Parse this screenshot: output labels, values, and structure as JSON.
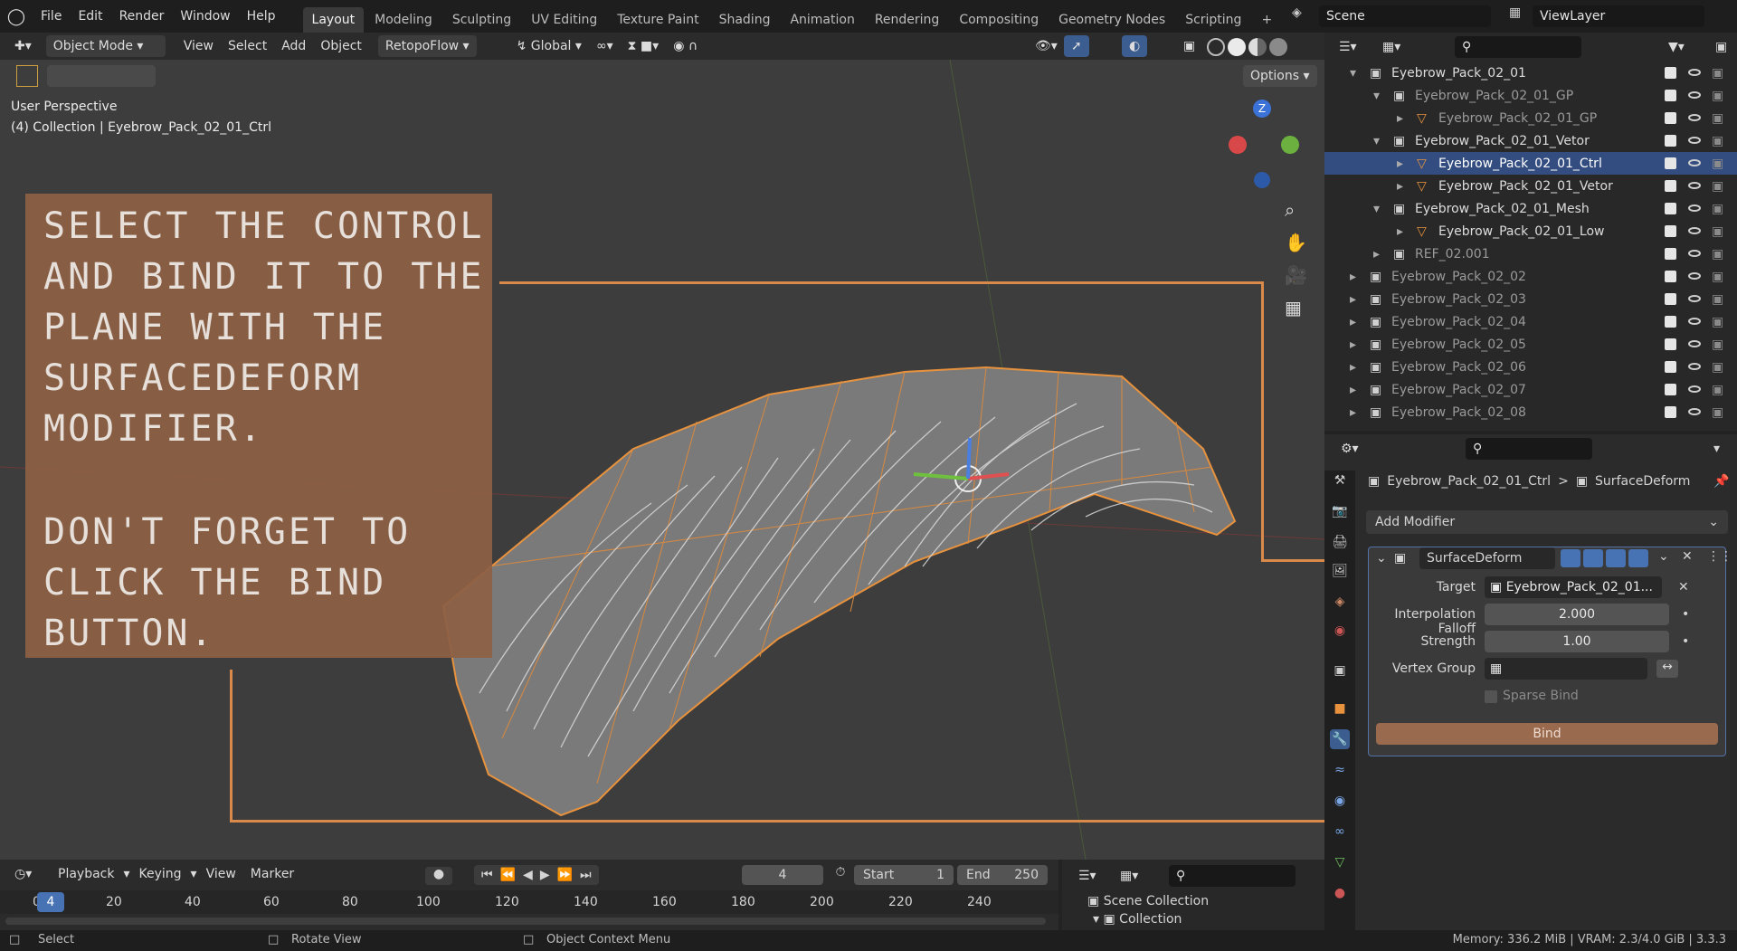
{
  "colors": {
    "accent": "#4772b3",
    "annotation": "#8d6045",
    "orange": "#d98a4a",
    "bind_button": "#9a6a4e"
  },
  "topbar": {
    "menus": [
      "File",
      "Edit",
      "Render",
      "Window",
      "Help"
    ],
    "workspaces": [
      "Layout",
      "Modeling",
      "Sculpting",
      "UV Editing",
      "Texture Paint",
      "Shading",
      "Animation",
      "Rendering",
      "Compositing",
      "Geometry Nodes",
      "Scripting"
    ],
    "active_workspace": "Layout",
    "add_tab": "+",
    "scene": "Scene",
    "view_layer": "ViewLayer"
  },
  "viewport_header": {
    "mode": "Object Mode",
    "menus": [
      "View",
      "Select",
      "Add",
      "Object"
    ],
    "addon": "RetopoFlow",
    "orientation": "Global",
    "options": "Options"
  },
  "viewport": {
    "perspective": "User Perspective",
    "collection_info": "(4) Collection | Eyebrow_Pack_02_01_Ctrl",
    "gizmo_z": "Z"
  },
  "annotation": {
    "text1": "Select the control and bind it to the plane with the SurfaceDeform modifier.",
    "text2": "Don't forget to click the Bind button."
  },
  "timeline": {
    "menus": [
      "Playback",
      "Keying",
      "View",
      "Marker"
    ],
    "current_frame": "4",
    "start_label": "Start",
    "start": "1",
    "end_label": "End",
    "end": "250",
    "ticks": [
      "0",
      "20",
      "40",
      "60",
      "80",
      "100",
      "120",
      "140",
      "160",
      "180",
      "200",
      "220",
      "240"
    ]
  },
  "outliner": {
    "rows": [
      {
        "label": "Eyebrow_Pack_02_01",
        "indent": 0,
        "dim": false
      },
      {
        "label": "Eyebrow_Pack_02_01_GP",
        "indent": 1,
        "dim": true
      },
      {
        "label": "Eyebrow_Pack_02_01_GP",
        "indent": 2,
        "dim": true
      },
      {
        "label": "Eyebrow_Pack_02_01_Vetor",
        "indent": 1,
        "dim": false
      },
      {
        "label": "Eyebrow_Pack_02_01_Ctrl",
        "indent": 2,
        "dim": false,
        "selected": true
      },
      {
        "label": "Eyebrow_Pack_02_01_Vetor",
        "indent": 2,
        "dim": false
      },
      {
        "label": "Eyebrow_Pack_02_01_Mesh",
        "indent": 1,
        "dim": false
      },
      {
        "label": "Eyebrow_Pack_02_01_Low",
        "indent": 2,
        "dim": false
      },
      {
        "label": "REF_02.001",
        "indent": 1,
        "dim": true
      },
      {
        "label": "Eyebrow_Pack_02_02",
        "indent": 0,
        "dim": true
      },
      {
        "label": "Eyebrow_Pack_02_03",
        "indent": 0,
        "dim": true
      },
      {
        "label": "Eyebrow_Pack_02_04",
        "indent": 0,
        "dim": true
      },
      {
        "label": "Eyebrow_Pack_02_05",
        "indent": 0,
        "dim": true
      },
      {
        "label": "Eyebrow_Pack_02_06",
        "indent": 0,
        "dim": true
      },
      {
        "label": "Eyebrow_Pack_02_07",
        "indent": 0,
        "dim": true
      },
      {
        "label": "Eyebrow_Pack_02_08",
        "indent": 0,
        "dim": true
      }
    ]
  },
  "properties": {
    "breadcrumb_object": "Eyebrow_Pack_02_01_Ctrl",
    "breadcrumb_sep": ">",
    "breadcrumb_modifier": "SurfaceDeform",
    "add_modifier": "Add Modifier",
    "modifier_name": "SurfaceDeform",
    "target_label": "Target",
    "target_value": "Eyebrow_Pack_02_01...",
    "falloff_label": "Interpolation Falloff",
    "falloff_value": "2.000",
    "strength_label": "Strength",
    "strength_value": "1.00",
    "vgroup_label": "Vertex Group",
    "sparse_label": "Sparse Bind",
    "bind_label": "Bind"
  },
  "bottom_outliner": {
    "scene_collection": "Scene Collection",
    "collection": "Collection"
  },
  "statusbar": {
    "select": "Select",
    "rotate": "Rotate View",
    "context": "Object Context Menu",
    "memory": "Memory: 336.2 MiB | VRAM: 2.3/4.0 GiB | 3.3.3"
  }
}
